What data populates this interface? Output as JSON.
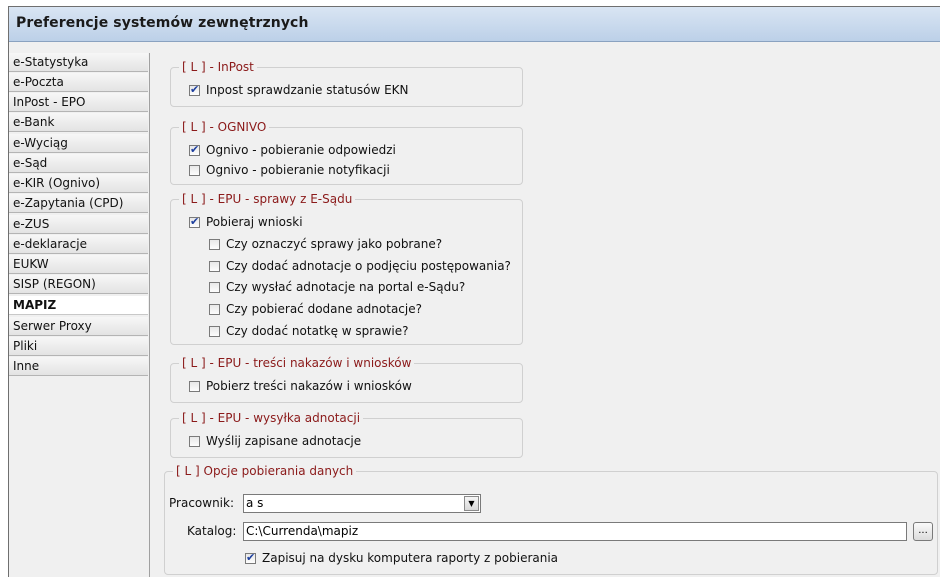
{
  "window": {
    "title": "Preferencje systemów zewnętrznych"
  },
  "sidebar": {
    "items": [
      {
        "label": "e-Statystyka"
      },
      {
        "label": "e-Poczta"
      },
      {
        "label": "InPost - EPO"
      },
      {
        "label": "e-Bank"
      },
      {
        "label": "e-Wyciąg"
      },
      {
        "label": "e-Sąd"
      },
      {
        "label": "e-KIR (Ognivo)"
      },
      {
        "label": "e-Zapytania (CPD)"
      },
      {
        "label": "e-ZUS"
      },
      {
        "label": "e-deklaracje"
      },
      {
        "label": "EUKW"
      },
      {
        "label": "SISP (REGON)"
      },
      {
        "label": "MAPIZ"
      },
      {
        "label": "Serwer Proxy"
      },
      {
        "label": "Pliki"
      },
      {
        "label": "Inne"
      }
    ],
    "active": "MAPIZ"
  },
  "groups": {
    "inpost": {
      "title": "[ L ] - InPost",
      "items": [
        {
          "label": "Inpost sprawdzanie statusów EKN",
          "checked": true
        }
      ]
    },
    "ognivo": {
      "title": "[ L ] - OGNIVO",
      "items": [
        {
          "label": "Ognivo - pobieranie odpowiedzi",
          "checked": true
        },
        {
          "label": "Ognivo - pobieranie notyfikacji",
          "checked": false
        }
      ]
    },
    "epu_sprawy": {
      "title": "[ L ] - EPU - sprawy z E-Sądu",
      "items": [
        {
          "label": "Pobieraj wnioski",
          "checked": true
        },
        {
          "label": "Czy oznaczyć sprawy jako pobrane?",
          "checked": false
        },
        {
          "label": "Czy dodać adnotacje o podjęciu postępowania?",
          "checked": false
        },
        {
          "label": "Czy wysłać adnotacje na portal e-Sądu?",
          "checked": false
        },
        {
          "label": "Czy pobierać dodane adnotacje?",
          "checked": false
        },
        {
          "label": "Czy dodać notatkę w sprawie?",
          "checked": false
        }
      ]
    },
    "epu_tresci": {
      "title": "[ L ] - EPU - treści nakazów i wniosków",
      "items": [
        {
          "label": "Pobierz treści nakazów i wniosków",
          "checked": false
        }
      ]
    },
    "epu_wysylka": {
      "title": "[ L ] - EPU - wysyłka adnotacji",
      "items": [
        {
          "label": "Wyślij zapisane adnotacje",
          "checked": false
        }
      ]
    },
    "opcje": {
      "title": "[ L ] Opcje pobierania danych",
      "pracownik_label": "Pracownik:",
      "pracownik_value": "a s",
      "katalog_label": "Katalog:",
      "katalog_value": "C:\\Currenda\\mapiz",
      "browse_label": "...",
      "zapisuj": {
        "label": "Zapisuj na dysku komputera raporty z pobierania",
        "checked": true
      }
    }
  }
}
